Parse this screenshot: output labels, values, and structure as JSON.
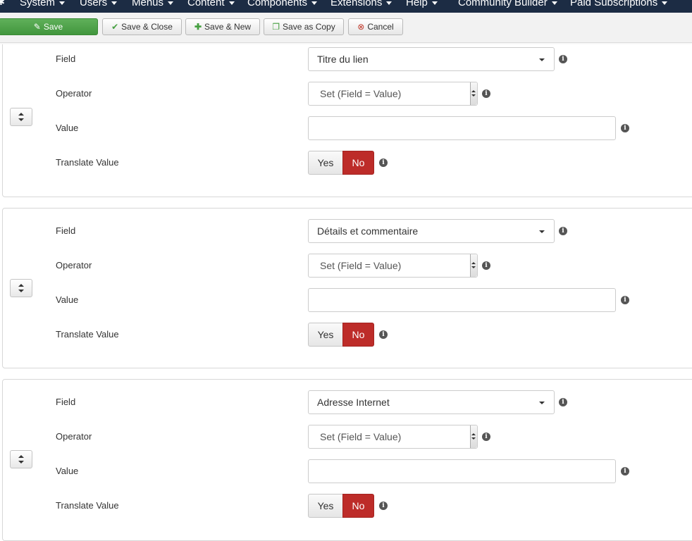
{
  "nav": {
    "items": [
      {
        "label": "System"
      },
      {
        "label": "Users"
      },
      {
        "label": "Menus"
      },
      {
        "label": "Content"
      },
      {
        "label": "Components"
      },
      {
        "label": "Extensions"
      },
      {
        "label": "Help"
      },
      {
        "label": "Community Builder"
      },
      {
        "label": "Paid Subscriptions"
      }
    ]
  },
  "toolbar": {
    "save_label": "Save",
    "save_close_label": "Save & Close",
    "save_new_label": "Save & New",
    "save_copy_label": "Save as Copy",
    "cancel_label": "Cancel"
  },
  "rows": [
    {
      "field_label": "Field",
      "field_value": "Titre du lien",
      "operator_label": "Operator",
      "operator_value": "Set (Field = Value)",
      "value_label": "Value",
      "value_value": "",
      "translate_label": "Translate Value",
      "yes_label": "Yes",
      "no_label": "No"
    },
    {
      "field_label": "Field",
      "field_value": "Détails et commentaire",
      "operator_label": "Operator",
      "operator_value": "Set (Field = Value)",
      "value_label": "Value",
      "value_value": "",
      "translate_label": "Translate Value",
      "yes_label": "Yes",
      "no_label": "No"
    },
    {
      "field_label": "Field",
      "field_value": "Adresse Internet",
      "operator_label": "Operator",
      "operator_value": "Set (Field = Value)",
      "value_label": "Value",
      "value_value": "",
      "translate_label": "Translate Value",
      "yes_label": "Yes",
      "no_label": "No"
    }
  ],
  "colors": {
    "nav_bg": "#1c2c44",
    "save_green": "#46a041",
    "no_active_red": "#bd2c29"
  }
}
